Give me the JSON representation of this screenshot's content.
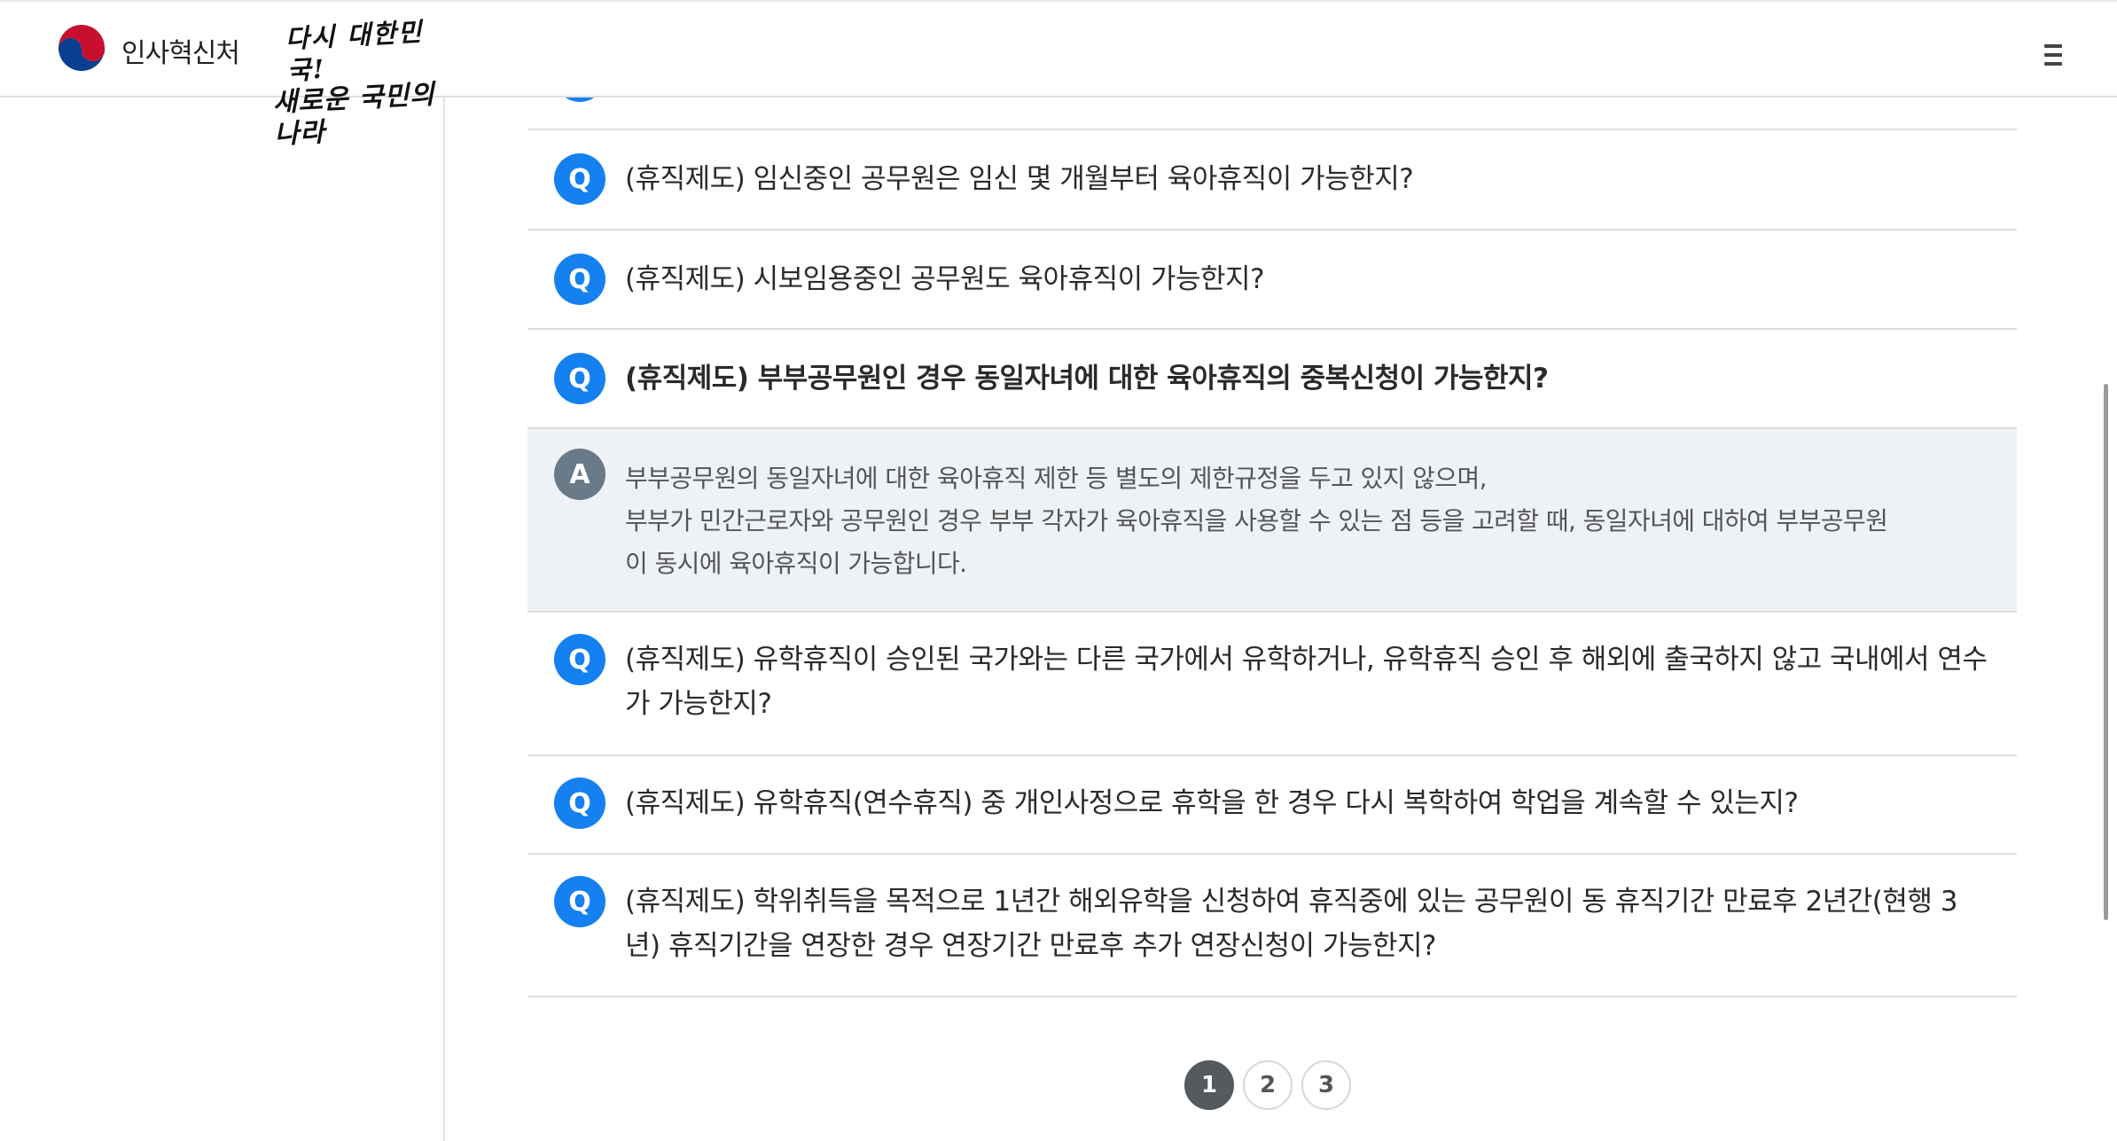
{
  "header": {
    "org_name": "인사혁신처",
    "slogan_line1": "다시 대한민국!",
    "slogan_line2": "새로운 국민의 나라",
    "menu_icon": "hamburger-menu-icon"
  },
  "faq": {
    "question_badge": "Q",
    "answer_badge": "A",
    "items": [
      {
        "question": "(휴직제도) 임신중인 공무원은 임신 몇 개월부터 육아휴직이 가능한지?"
      },
      {
        "question": "(휴직제도) 시보임용중인 공무원도 육아휴직이 가능한지?"
      },
      {
        "question": "(휴직제도) 부부공무원인 경우 동일자녀에 대한 육아휴직의 중복신청이 가능한지?"
      },
      {
        "question": "(휴직제도) 유학휴직이 승인된 국가와는 다른 국가에서 유학하거나, 유학휴직 승인 후 해외에 출국하지 않고 국내에서 연수가 가능한지?"
      },
      {
        "question": "(휴직제도) 유학휴직(연수휴직) 중 개인사정으로 휴학을 한 경우 다시 복학하여 학업을 계속할 수 있는지?"
      },
      {
        "question": "(휴직제도) 학위취득을 목적으로 1년간 해외유학을 신청하여 휴직중에 있는 공무원이 동 휴직기간 만료후 2년간(현행 3년) 휴직기간을 연장한 경우 연장기간 만료후 추가 연장신청이 가능한지?"
      }
    ],
    "expanded_answer": {
      "line1": "부부공무원의 동일자녀에 대한 육아휴직 제한 등 별도의 제한규정을 두고 있지 않으며,",
      "line2": "부부가 민간근로자와 공무원인 경우 부부 각자가 육아휴직을 사용할 수 있는 점 등을 고려할 때, 동일자녀에 대하여 부부공무원",
      "line3": "이 동시에 육아휴직이 가능합니다."
    }
  },
  "pagination": {
    "pages": [
      "1",
      "2",
      "3"
    ],
    "current": "1"
  }
}
